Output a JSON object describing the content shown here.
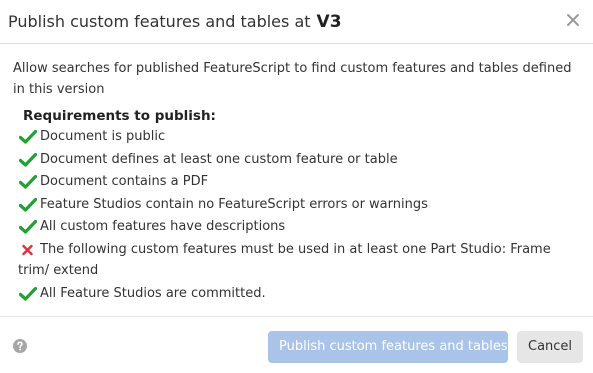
{
  "dialog": {
    "title": "Publish custom features and tables at",
    "version": "V3"
  },
  "body": {
    "intro": "Allow searches for published FeatureScript to find custom features and tables defined in this version",
    "requirements_heading": "Requirements to publish:",
    "requirements": [
      {
        "status": "pass",
        "text": "Document is public"
      },
      {
        "status": "pass",
        "text": "Document defines at least one custom feature or table"
      },
      {
        "status": "pass",
        "text": "Document contains a PDF"
      },
      {
        "status": "pass",
        "text": "Feature Studios contain no FeatureScript errors or warnings"
      },
      {
        "status": "pass",
        "text": "All custom features have descriptions"
      },
      {
        "status": "fail",
        "text": "The following custom features must be used in at least one Part Studio: Frame trim/ extend"
      },
      {
        "status": "pass",
        "text": "All Feature Studios are committed."
      }
    ]
  },
  "footer": {
    "publish_label": "Publish custom features and tables",
    "cancel_label": "Cancel"
  },
  "colors": {
    "pass": "#22a033",
    "fail": "#d9343a",
    "publish_disabled": "#a9c4e8"
  },
  "icons": {
    "close": "close-icon",
    "help": "help-icon",
    "pass": "checkmark-icon",
    "fail": "x-mark-icon"
  }
}
